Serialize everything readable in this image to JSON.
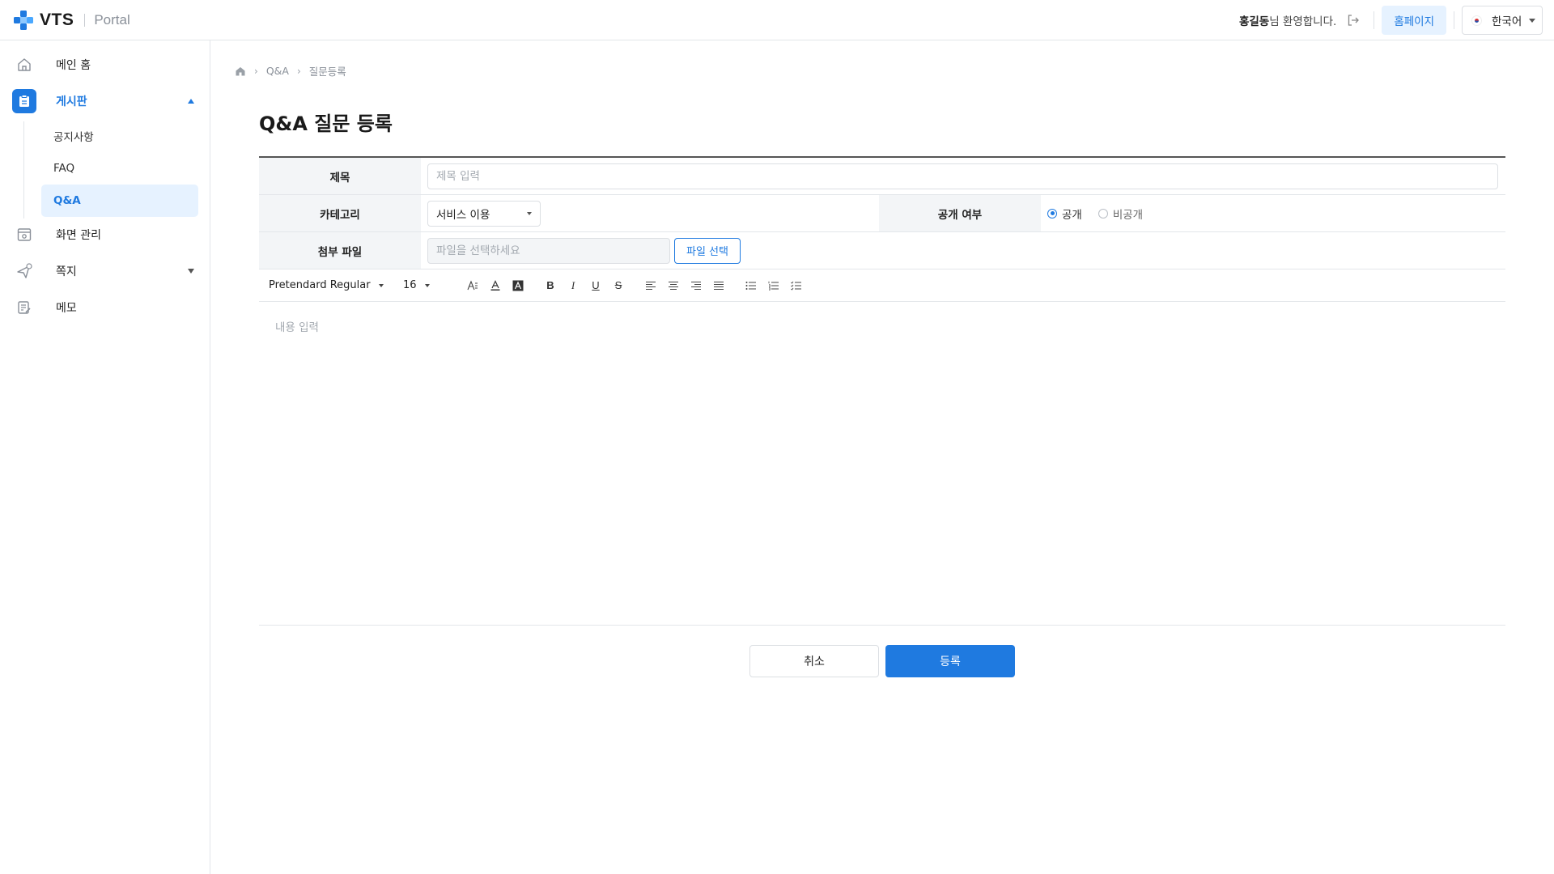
{
  "header": {
    "logo_text": "VTS",
    "logo_sub": "Portal",
    "user_name": "홍길동",
    "welcome_suffix": "님 환영합니다.",
    "homepage_label": "홈페이지",
    "language_label": "한국어",
    "logout_icon": "logout-icon",
    "brand_color": "#1f7ae0"
  },
  "sidebar": {
    "items": [
      {
        "label": "메인 홈",
        "icon": "home-icon"
      },
      {
        "label": "게시판",
        "icon": "board-icon",
        "expanded": true
      },
      {
        "label": "화면 관리",
        "icon": "screen-settings-icon"
      },
      {
        "label": "쪽지",
        "icon": "message-icon",
        "expanded": false
      },
      {
        "label": "메모",
        "icon": "memo-icon"
      }
    ],
    "sub_items": [
      {
        "label": "공지사항"
      },
      {
        "label": "FAQ"
      },
      {
        "label": "Q&A",
        "active": true
      }
    ]
  },
  "breadcrumb": {
    "items": [
      "Q&A",
      "질문등록"
    ],
    "separator": "›"
  },
  "page": {
    "title": "Q&A 질문 등록"
  },
  "form": {
    "title_label": "제목",
    "title_placeholder": "제목 입력",
    "category_label": "카테고리",
    "category_value": "서비스 이용",
    "visibility_label": "공개 여부",
    "visibility_options": [
      {
        "label": "공개",
        "selected": true
      },
      {
        "label": "비공개",
        "selected": false
      }
    ],
    "attachment_label": "첨부 파일",
    "attachment_placeholder": "파일을 선택하세요",
    "file_button": "파일 선택"
  },
  "editor": {
    "font_family": "Pretendard Regular",
    "font_size": "16",
    "placeholder": "내용 입력",
    "buttons": [
      "font-size-icon",
      "font-color-icon",
      "background-color-icon",
      "bold-icon",
      "italic-icon",
      "underline-icon",
      "strikethrough-icon",
      "align-left-icon",
      "align-center-icon",
      "align-right-icon",
      "align-justify-icon",
      "bullet-list-icon",
      "numbered-list-icon",
      "checklist-icon"
    ]
  },
  "actions": {
    "cancel": "취소",
    "submit": "등록"
  }
}
